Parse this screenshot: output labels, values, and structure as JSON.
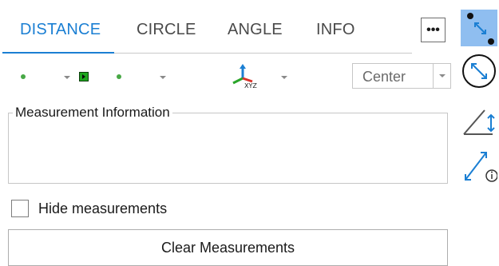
{
  "tabs": [
    {
      "label": "DISTANCE",
      "active": true
    },
    {
      "label": "CIRCLE",
      "active": false
    },
    {
      "label": "ANGLE",
      "active": false
    },
    {
      "label": "INFO",
      "active": false
    }
  ],
  "more_button": {
    "icon": "ellipsis-icon",
    "label": "•••"
  },
  "side_tools": [
    {
      "icon": "point-distance-icon",
      "selected": true
    },
    {
      "icon": "circle-measure-icon",
      "selected": false
    },
    {
      "icon": "angle-measure-icon",
      "selected": false
    },
    {
      "icon": "info-measure-icon",
      "selected": false
    }
  ],
  "toolbar": {
    "point1_icon": "green-dot-icon",
    "snap_icon": "green-square-play-icon",
    "point2_icon": "green-dot-icon",
    "axes_icon": "xyz-axes-icon",
    "axes_text": "XYZ",
    "mode_select": {
      "value": "Center"
    }
  },
  "measurement_info": {
    "legend": "Measurement Information",
    "content": ""
  },
  "hide_measurements": {
    "label": "Hide measurements",
    "checked": false
  },
  "clear_button": {
    "label": "Clear Measurements"
  },
  "colors": {
    "accent": "#1b7fd3",
    "selected_bg": "#8fbef0",
    "green": "#48a846"
  }
}
